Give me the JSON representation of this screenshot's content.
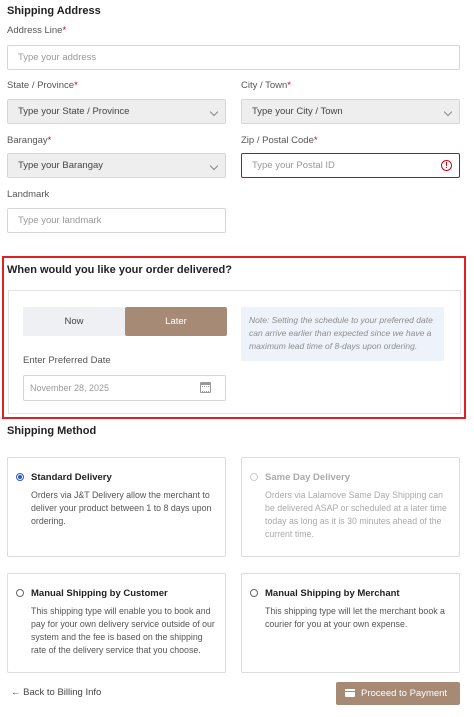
{
  "shipping_address": {
    "title": "Shipping Address",
    "address_line": {
      "label": "Address Line",
      "placeholder": "Type your address"
    },
    "state": {
      "label": "State / Province",
      "value": "Type your State / Province"
    },
    "city": {
      "label": "City / Town",
      "value": "Type your City / Town"
    },
    "barangay": {
      "label": "Barangay",
      "value": "Type your Barangay"
    },
    "zip": {
      "label": "Zip / Postal Code",
      "placeholder": "Type your Postal ID",
      "error_icon": "!"
    },
    "landmark": {
      "label": "Landmark",
      "placeholder": "Type your landmark"
    },
    "required_mark": "*"
  },
  "delivery": {
    "title": "When would you like your order delivered?",
    "now_label": "Now",
    "later_label": "Later",
    "selected": "Later",
    "note": "Note: Setting the schedule to your preferred date can arrive earlier than expected since we have a maximum lead time of 8-days upon ordering.",
    "date_label": "Enter Preferred Date",
    "date_placeholder": "November 28, 2025"
  },
  "shipping_method": {
    "title": "Shipping Method",
    "options": [
      {
        "title": "Standard Delivery",
        "description": "Orders via J&T Delivery allow the merchant to deliver your product between 1 to 8 days upon ordering.",
        "selected": true,
        "disabled": false
      },
      {
        "title": "Same Day Delivery",
        "description": "Orders via Lalamove Same Day Shipping can be delivered ASAP or scheduled at a later time today as long as it is 30 minutes ahead of the current time.",
        "selected": false,
        "disabled": true
      },
      {
        "title": "Manual Shipping by Customer",
        "description": "This shipping type will enable you to book and pay for your own delivery service outside of our system and the fee is based on the shipping rate of the delivery service that you choose.",
        "selected": false,
        "disabled": false
      },
      {
        "title": "Manual Shipping by Merchant",
        "description": "This shipping type will let the merchant book a courier for you at your own expense.",
        "selected": false,
        "disabled": false
      }
    ]
  },
  "footer": {
    "back_label": "← Back to Billing Info",
    "proceed_label": "Proceed to Payment"
  },
  "colors": {
    "accent": "#a68a76",
    "error": "#d0021b",
    "radio_selected": "#2e57c8",
    "highlight_border": "#e02020"
  },
  "icons": {
    "select": "chevron-down-icon",
    "error": "error-circle-icon",
    "date": "calendar-icon",
    "back": "arrow-left-icon",
    "pay": "credit-card-icon"
  }
}
